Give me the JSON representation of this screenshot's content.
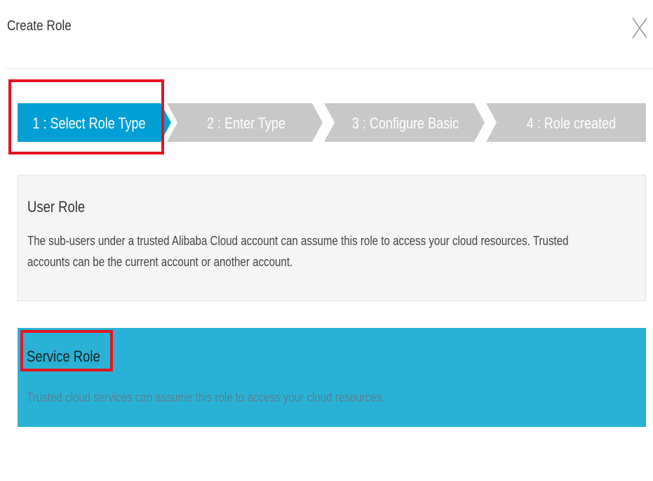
{
  "dialog": {
    "title": "Create Role",
    "close_icon": "close-icon"
  },
  "steps": [
    {
      "label": "1 : Select Role Type",
      "state": "active"
    },
    {
      "label": "2 : Enter Type",
      "state": "inactive"
    },
    {
      "label": "3 : Configure Basic",
      "state": "inactive"
    },
    {
      "label": "4 : Role created",
      "state": "inactive"
    }
  ],
  "role_types": [
    {
      "title": "User Role",
      "description_line1": "The sub-users under a trusted Alibaba Cloud account can assume this role to access your cloud resources. Trusted",
      "description_line2": "accounts can be the current account or another account.",
      "selected": false
    },
    {
      "title": "Service Role",
      "description": "Trusted cloud services can assume this role to access your cloud resources.",
      "selected": true
    }
  ],
  "colors": {
    "accent": "#009fd6",
    "inactive_step": "#c8c8c8",
    "selected_card": "#29b2d6",
    "annotation_red": "#e3141f"
  }
}
